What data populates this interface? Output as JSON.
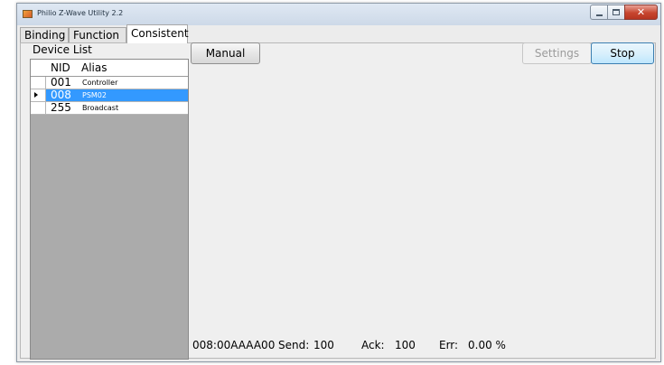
{
  "window": {
    "title": "Philio Z-Wave Utility 2.2",
    "close_glyph": "✕"
  },
  "tabs": [
    {
      "label": "Binding"
    },
    {
      "label": "Function"
    },
    {
      "label": "Consistent",
      "selected": true
    }
  ],
  "device_list": {
    "title": "Device List",
    "columns": {
      "nid": "NID",
      "alias": "Alias"
    },
    "rows": [
      {
        "nid": "001",
        "alias": "Controller",
        "selected": false
      },
      {
        "nid": "008",
        "alias": "PSM02",
        "selected": true
      },
      {
        "nid": "255",
        "alias": "Broadcast",
        "selected": false
      }
    ]
  },
  "toolbar": {
    "manual_label": "Manual",
    "settings_label": "Settings",
    "settings_enabled": false,
    "stop_label": "Stop"
  },
  "status": {
    "address": "008:00AAAA00",
    "send_label": "Send:",
    "send_value": "100",
    "ack_label": "Ack:",
    "ack_value": "100",
    "err_label": "Err:",
    "err_value": "0.00 %"
  },
  "colors": {
    "selection": "#3399ff",
    "grid_background": "#ababab",
    "panel_background": "#efefef"
  },
  "icons": {
    "app": "app-icon",
    "row_selector": "row-selector-arrow-icon"
  }
}
